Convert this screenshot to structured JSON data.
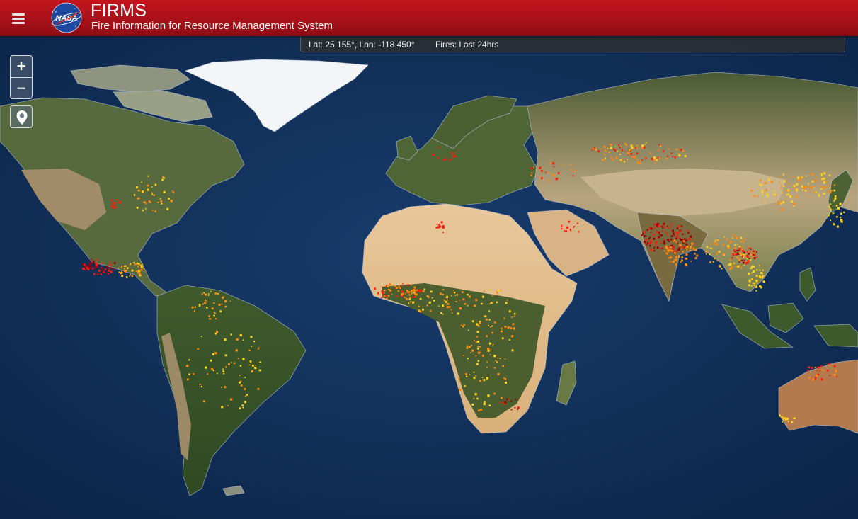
{
  "header": {
    "title": "FIRMS",
    "subtitle": "Fire Information for Resource Management System",
    "logo_text": "NASA",
    "menu_icon": "hamburger-menu-icon",
    "background_color": "#b3121a"
  },
  "status_bar": {
    "coordinates": "Lat: 25.155°, Lon: -118.450°",
    "fires_filter": "Fires: Last 24hrs"
  },
  "map_controls": {
    "zoom_in_label": "+",
    "zoom_out_label": "−",
    "locate_icon": "map-marker-icon"
  },
  "map": {
    "ocean_color": "#12305c",
    "fire_colors": [
      "#ff1a0a",
      "#ff8a10",
      "#ffd21a",
      "#9e0000"
    ]
  }
}
